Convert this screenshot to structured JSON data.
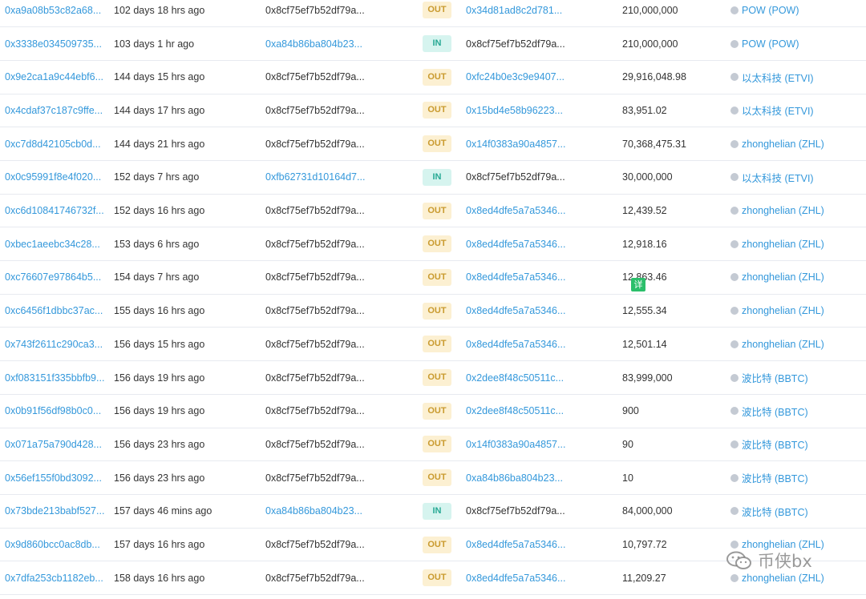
{
  "transfers": [
    {
      "hash": "0xa9a08b53c82a68...",
      "age": "102 days 18 hrs ago",
      "from": "0x8cf75ef7b52df79a...",
      "dir": "OUT",
      "to": "0x34d81ad8c2d781...",
      "value": "210,000,000",
      "token": "POW (POW)"
    },
    {
      "hash": "0x3338e034509735...",
      "age": "103 days 1 hr ago",
      "from": "0xa84b86ba804b23...",
      "dir": "IN",
      "to": "0x8cf75ef7b52df79a...",
      "value": "210,000,000",
      "token": "POW (POW)"
    },
    {
      "hash": "0x9e2ca1a9c44ebf6...",
      "age": "144 days 15 hrs ago",
      "from": "0x8cf75ef7b52df79a...",
      "dir": "OUT",
      "to": "0xfc24b0e3c9e9407...",
      "value": "29,916,048.98",
      "token": "以太科技 (ETVI)"
    },
    {
      "hash": "0x4cdaf37c187c9ffe...",
      "age": "144 days 17 hrs ago",
      "from": "0x8cf75ef7b52df79a...",
      "dir": "OUT",
      "to": "0x15bd4e58b96223...",
      "value": "83,951.02",
      "token": "以太科技 (ETVI)"
    },
    {
      "hash": "0xc7d8d42105cb0d...",
      "age": "144 days 21 hrs ago",
      "from": "0x8cf75ef7b52df79a...",
      "dir": "OUT",
      "to": "0x14f0383a90a4857...",
      "value": "70,368,475.31",
      "token": "zhonghelian (ZHL)"
    },
    {
      "hash": "0x0c95991f8e4f020...",
      "age": "152 days 7 hrs ago",
      "from": "0xfb62731d10164d7...",
      "dir": "IN",
      "to": "0x8cf75ef7b52df79a...",
      "value": "30,000,000",
      "token": "以太科技 (ETVI)"
    },
    {
      "hash": "0xc6d10841746732f...",
      "age": "152 days 16 hrs ago",
      "from": "0x8cf75ef7b52df79a...",
      "dir": "OUT",
      "to": "0x8ed4dfe5a7a5346...",
      "value": "12,439.52",
      "token": "zhonghelian (ZHL)"
    },
    {
      "hash": "0xbec1aeebc34c28...",
      "age": "153 days 6 hrs ago",
      "from": "0x8cf75ef7b52df79a...",
      "dir": "OUT",
      "to": "0x8ed4dfe5a7a5346...",
      "value": "12,918.16",
      "token": "zhonghelian (ZHL)"
    },
    {
      "hash": "0xc76607e97864b5...",
      "age": "154 days 7 hrs ago",
      "from": "0x8cf75ef7b52df79a...",
      "dir": "OUT",
      "to": "0x8ed4dfe5a7a5346...",
      "value": "12,863.46",
      "token": "zhonghelian (ZHL)"
    },
    {
      "hash": "0xc6456f1dbbc37ac...",
      "age": "155 days 16 hrs ago",
      "from": "0x8cf75ef7b52df79a...",
      "dir": "OUT",
      "to": "0x8ed4dfe5a7a5346...",
      "value": "12,555.34",
      "token": "zhonghelian (ZHL)"
    },
    {
      "hash": "0x743f2611c290ca3...",
      "age": "156 days 15 hrs ago",
      "from": "0x8cf75ef7b52df79a...",
      "dir": "OUT",
      "to": "0x8ed4dfe5a7a5346...",
      "value": "12,501.14",
      "token": "zhonghelian (ZHL)"
    },
    {
      "hash": "0xf083151f335bbfb9...",
      "age": "156 days 19 hrs ago",
      "from": "0x8cf75ef7b52df79a...",
      "dir": "OUT",
      "to": "0x2dee8f48c50511c...",
      "value": "83,999,000",
      "token": "波比特 (BBTC)"
    },
    {
      "hash": "0x0b91f56df98b0c0...",
      "age": "156 days 19 hrs ago",
      "from": "0x8cf75ef7b52df79a...",
      "dir": "OUT",
      "to": "0x2dee8f48c50511c...",
      "value": "900",
      "token": "波比特 (BBTC)"
    },
    {
      "hash": "0x071a75a790d428...",
      "age": "156 days 23 hrs ago",
      "from": "0x8cf75ef7b52df79a...",
      "dir": "OUT",
      "to": "0x14f0383a90a4857...",
      "value": "90",
      "token": "波比特 (BBTC)"
    },
    {
      "hash": "0x56ef155f0bd3092...",
      "age": "156 days 23 hrs ago",
      "from": "0x8cf75ef7b52df79a...",
      "dir": "OUT",
      "to": "0xa84b86ba804b23...",
      "value": "10",
      "token": "波比特 (BBTC)"
    },
    {
      "hash": "0x73bde213babf527...",
      "age": "157 days 46 mins ago",
      "from": "0xa84b86ba804b23...",
      "dir": "IN",
      "to": "0x8cf75ef7b52df79a...",
      "value": "84,000,000",
      "token": "波比特 (BBTC)"
    },
    {
      "hash": "0x9d860bcc0ac8db...",
      "age": "157 days 16 hrs ago",
      "from": "0x8cf75ef7b52df79a...",
      "dir": "OUT",
      "to": "0x8ed4dfe5a7a5346...",
      "value": "10,797.72",
      "token": "zhonghelian (ZHL)"
    },
    {
      "hash": "0x7dfa253cb1182eb...",
      "age": "158 days 16 hrs ago",
      "from": "0x8cf75ef7b52df79a...",
      "dir": "OUT",
      "to": "0x8ed4dfe5a7a5346...",
      "value": "11,209.27",
      "token": "zhonghelian (ZHL)"
    }
  ],
  "overlay_sticker": "详",
  "watermark_text": "币侠bx",
  "colors": {
    "link": "#3498db",
    "out_badge_bg": "#fcf0d2",
    "out_badge_text": "#c99a2e",
    "in_badge_bg": "#d6f4ef",
    "in_badge_text": "#27a994"
  }
}
